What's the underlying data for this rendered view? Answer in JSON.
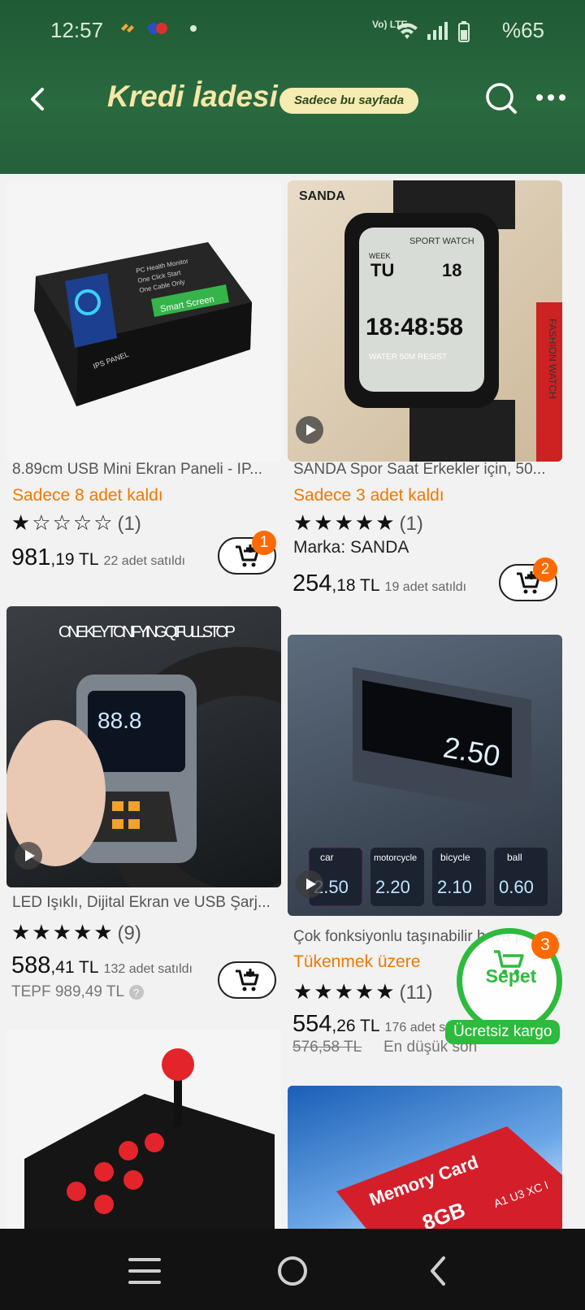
{
  "status_bar": {
    "time": "12:57",
    "battery": "%65",
    "network": "Vo) LTE"
  },
  "header": {
    "title": "Kredi İadesi",
    "badge": "Sadece bu sayfada"
  },
  "products": [
    {
      "name": "8.89cm USB Mini Ekran Paneli - IP...",
      "stock": "Sadece 8 adet kaldı",
      "stars": "★☆☆☆☆",
      "rating_count": "(1)",
      "price_int": "981",
      "price_dec": ",19 TL",
      "sold": "22 adet satıldı",
      "cart_count": "1",
      "image": {
        "title": "Smart Screen",
        "lines": [
          "PC Health Monitor",
          "One Click Start",
          "One Cable Only"
        ],
        "panel": "IPS PANEL"
      }
    },
    {
      "name": "SANDA Spor Saat Erkekler için, 50...",
      "stock": "Sadece 3 adet kaldı",
      "stars": "★★★★★",
      "rating_count": "(1)",
      "brand": "Marka: SANDA",
      "price_int": "254",
      "price_dec": ",18 TL",
      "sold": "19 adet satıldı",
      "cart_count": "2",
      "image": {
        "brand": "SANDA",
        "face": "SPORT WATCH",
        "time": "18:48:58",
        "bottom": "WATER 50M RESIST",
        "side": "FASHION WATCH",
        "week": "WEEK",
        "day": "TU",
        "date": "18"
      }
    },
    {
      "name": "LED Işıklı, Dijital Ekran ve USB Şarj...",
      "stars": "★★★★★",
      "rating_count": "(9)",
      "price_int": "588",
      "price_dec": ",41 TL",
      "sold": "132 adet satıldı",
      "tepf": "TEPF 989,49 TL",
      "image": {
        "caption": "ONE KEY TONIFYING QI FULL STOP",
        "reading": "88.8"
      }
    },
    {
      "name": "Çok fonksiyonlu taşınabilir hava p...",
      "stock": "Tükenmek üzere",
      "stars": "★★★★★",
      "rating_count": "(11)",
      "price_int": "554",
      "price_dec": ",26 TL",
      "sold": "176 adet sa",
      "old_price": "576,58 TL",
      "note": "En düşük son",
      "image": {
        "modes": [
          {
            "label": "car",
            "value": "2.50"
          },
          {
            "label": "motorcycle",
            "value": "2.20"
          },
          {
            "label": "bicycle",
            "value": "2.10"
          },
          {
            "label": "ball",
            "value": "0.60"
          }
        ],
        "display": "2.50"
      }
    },
    {
      "name": "Arcade joystick",
      "image": {
        "caption": ""
      }
    },
    {
      "name": "Memory Card",
      "image": {
        "title": "Memory Card",
        "size": "8GB",
        "badges": "A1 U3 XC I"
      }
    }
  ],
  "floating_cart": {
    "label": "Sepet",
    "count": "3",
    "shipping": "Ücretsiz kargo"
  },
  "colors": {
    "header": "#24603a",
    "accent": "#f07800",
    "cart_green": "#2dbb3d",
    "badge": "#ff6a00"
  }
}
